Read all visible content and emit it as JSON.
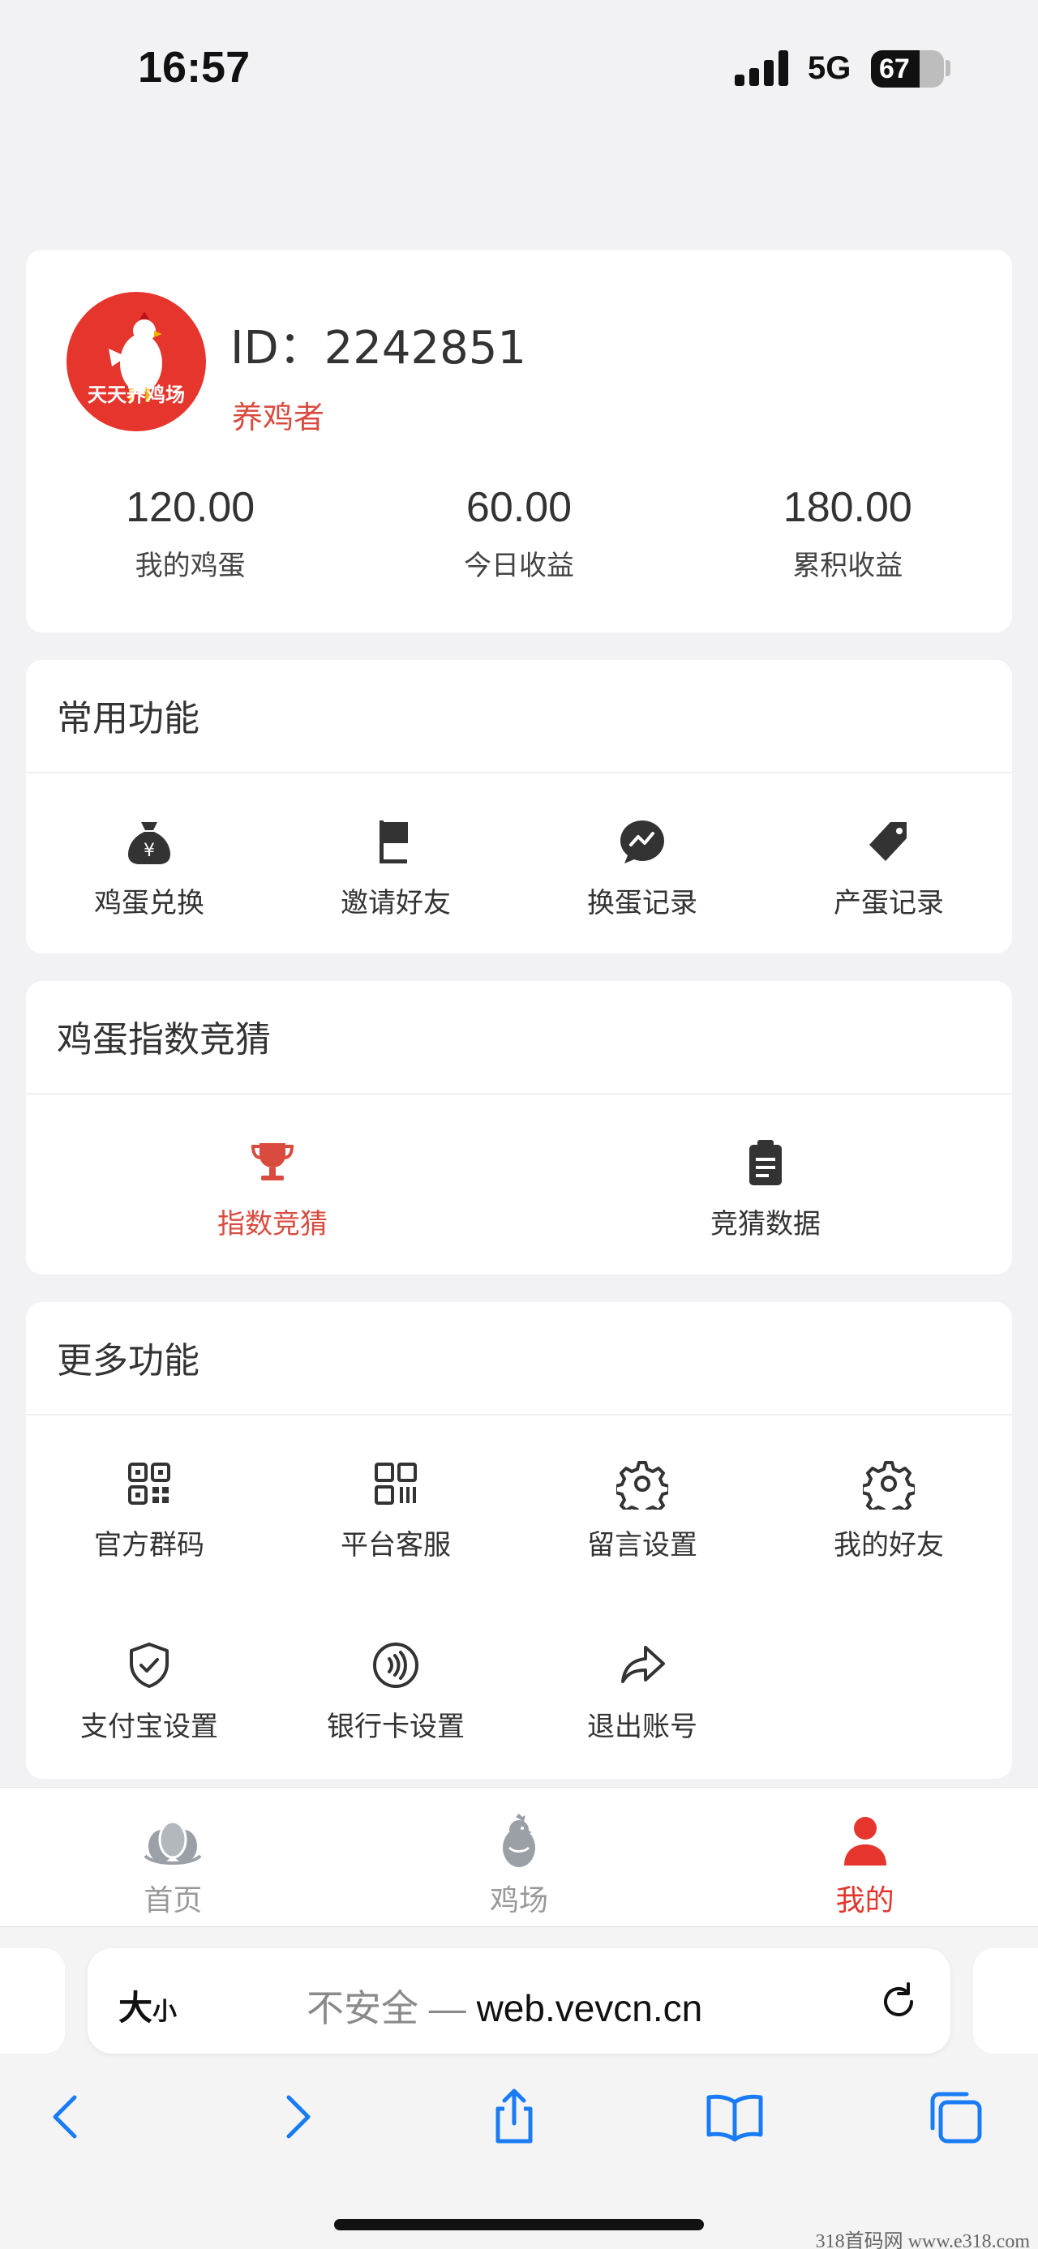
{
  "status_bar": {
    "time": "16:57",
    "network": "5G",
    "battery": "67"
  },
  "profile": {
    "avatar_text": "天天养鸡场",
    "user_id": "ID：2242851",
    "role": "养鸡者",
    "stats": [
      {
        "value": "120.00",
        "label": "我的鸡蛋"
      },
      {
        "value": "60.00",
        "label": "今日收益"
      },
      {
        "value": "180.00",
        "label": "累积收益"
      }
    ]
  },
  "common": {
    "title": "常用功能",
    "items": [
      {
        "label": "鸡蛋兑换",
        "icon": "money-bag-icon"
      },
      {
        "label": "邀请好友",
        "icon": "flag-icon"
      },
      {
        "label": "换蛋记录",
        "icon": "chat-icon"
      },
      {
        "label": "产蛋记录",
        "icon": "tag-icon"
      }
    ]
  },
  "guess": {
    "title": "鸡蛋指数竞猜",
    "items": [
      {
        "label": "指数竞猜",
        "icon": "trophy-icon"
      },
      {
        "label": "竞猜数据",
        "icon": "clipboard-icon"
      }
    ]
  },
  "more": {
    "title": "更多功能",
    "items": [
      {
        "label": "官方群码",
        "icon": "qr-code-icon"
      },
      {
        "label": "平台客服",
        "icon": "grid-code-icon"
      },
      {
        "label": "留言设置",
        "icon": "gear-icon"
      },
      {
        "label": "我的好友",
        "icon": "gear-icon"
      },
      {
        "label": "支付宝设置",
        "icon": "shield-check-icon"
      },
      {
        "label": "银行卡设置",
        "icon": "contactless-icon"
      },
      {
        "label": "退出账号",
        "icon": "share-arrow-icon"
      }
    ]
  },
  "tabbar": [
    {
      "label": "首页",
      "icon": "eggs-icon"
    },
    {
      "label": "鸡场",
      "icon": "chicken-icon"
    },
    {
      "label": "我的",
      "icon": "user-icon"
    }
  ],
  "browser": {
    "text_size": "大",
    "text_size_small": "小",
    "insecure": "不安全",
    "separator": " — ",
    "domain": "web.vevcn.cn"
  },
  "watermark": "318首码网  www.e318.com",
  "colors": {
    "accent": "#e5352c",
    "accent_text": "#d94b3f",
    "icon": "#333333",
    "ios_blue": "#1a7cf5"
  }
}
